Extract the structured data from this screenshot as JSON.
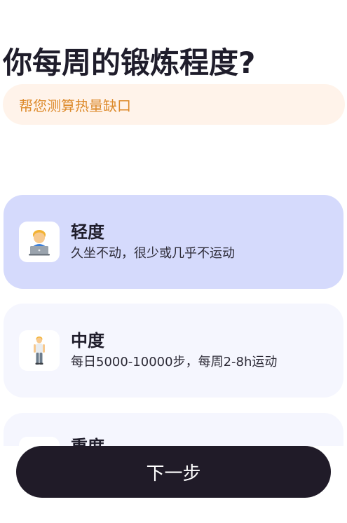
{
  "page": {
    "title": "你每周的锻炼程度?",
    "subtitle": "帮您测算热量缺口"
  },
  "options": [
    {
      "label": "轻度",
      "description": "久坐不动，很少或几乎不运动",
      "icon": "person-at-laptop-icon",
      "selected": true
    },
    {
      "label": "中度",
      "description": "每日5000-10000步，每周2-8h运动",
      "icon": "person-standing-icon",
      "selected": false
    },
    {
      "label": "重度",
      "description": "",
      "icon": "",
      "selected": false
    }
  ],
  "footer": {
    "next_label": "下一步"
  },
  "colors": {
    "selected_card": "#d5dafc",
    "card": "#f5f6fe",
    "subtitle_bg": "#fff3ea",
    "subtitle_text": "#dd8a2b",
    "button_bg": "#201b28"
  }
}
